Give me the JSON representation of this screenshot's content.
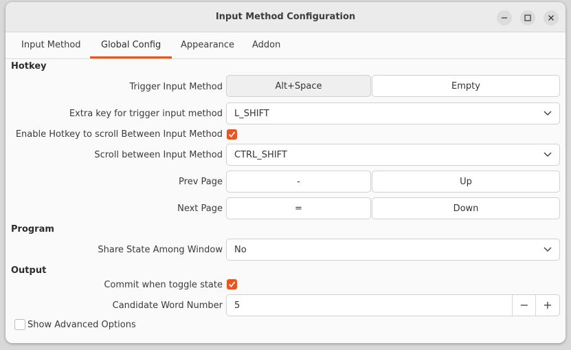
{
  "window": {
    "title": "Input Method Configuration"
  },
  "tabs": [
    {
      "label": "Input Method"
    },
    {
      "label": "Global Config"
    },
    {
      "label": "Appearance"
    },
    {
      "label": "Addon"
    }
  ],
  "accent_color": "#e95420",
  "hotkey": {
    "heading": "Hotkey",
    "trigger_label": "Trigger Input Method",
    "trigger_key1": "Alt+Space",
    "trigger_key2": "Empty",
    "extra_label": "Extra key for trigger input method",
    "extra_value": "L_SHIFT",
    "enable_scroll_label": "Enable Hotkey to scroll Between Input Method",
    "enable_scroll_checked": true,
    "scroll_label": "Scroll between Input Method",
    "scroll_value": "CTRL_SHIFT",
    "prev_label": "Prev Page",
    "prev_key1": "-",
    "prev_key2": "Up",
    "next_label": "Next Page",
    "next_key1": "=",
    "next_key2": "Down"
  },
  "program": {
    "heading": "Program",
    "share_label": "Share State Among Window",
    "share_value": "No"
  },
  "output": {
    "heading": "Output",
    "commit_label": "Commit when toggle state",
    "commit_checked": true,
    "candidate_label": "Candidate Word Number",
    "candidate_value": "5",
    "minus": "−",
    "plus": "+"
  },
  "advanced": {
    "label": "Show Advanced Options",
    "checked": false
  }
}
